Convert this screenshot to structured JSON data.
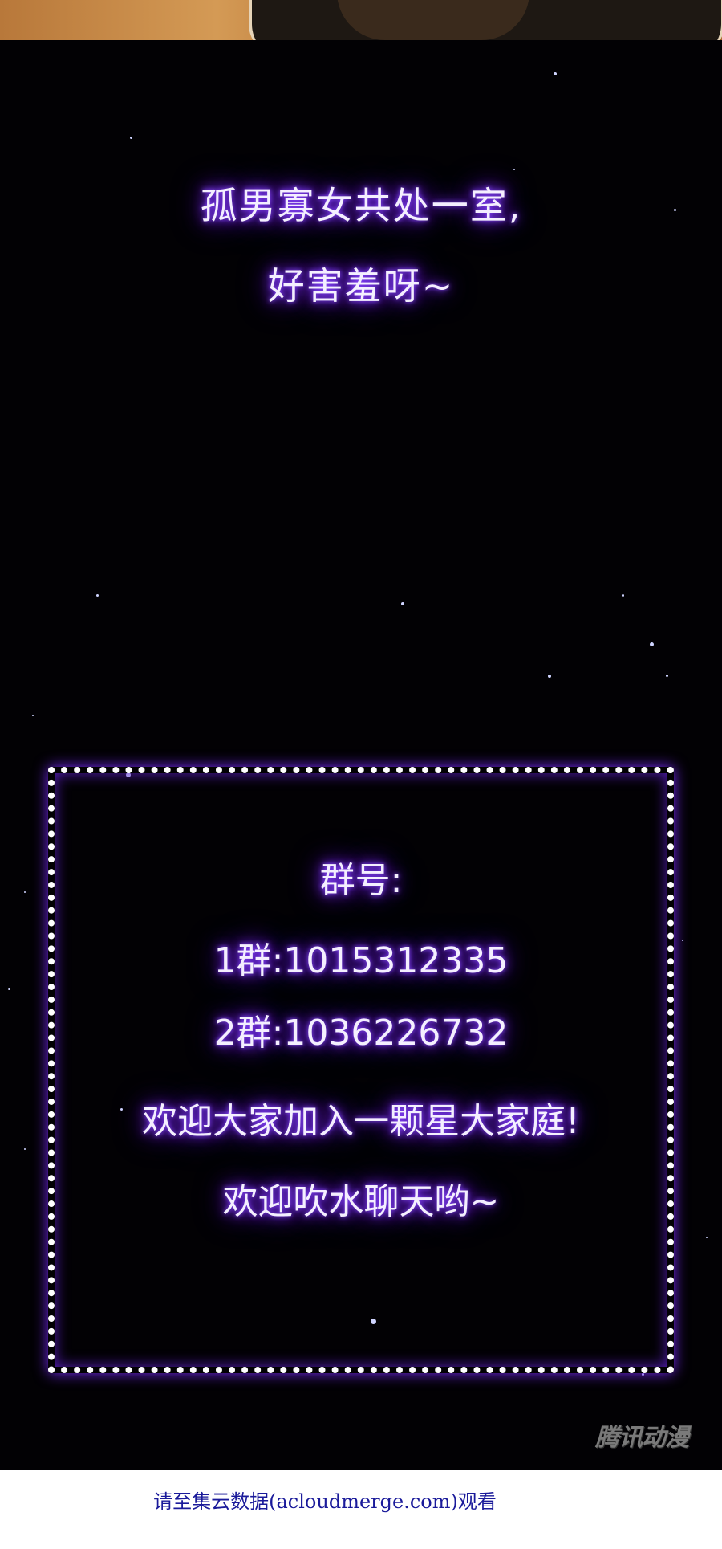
{
  "intro": {
    "line1": "孤男寡女共处一室,",
    "line2": "好害羞呀~"
  },
  "group_box": {
    "heading": "群号:",
    "group1": "1群:1015312335",
    "group2": "2群:1036226732",
    "welcome1": "欢迎大家加入一颗星大家庭!",
    "welcome2": "欢迎吹水聊天哟~"
  },
  "watermark": "腾讯动漫",
  "footer": {
    "text": "请至集云数据(acloudmerge.com)观看"
  },
  "colors": {
    "background": "#020104",
    "glow": "#7a2bff",
    "footer_link": "#1a1a9a"
  }
}
